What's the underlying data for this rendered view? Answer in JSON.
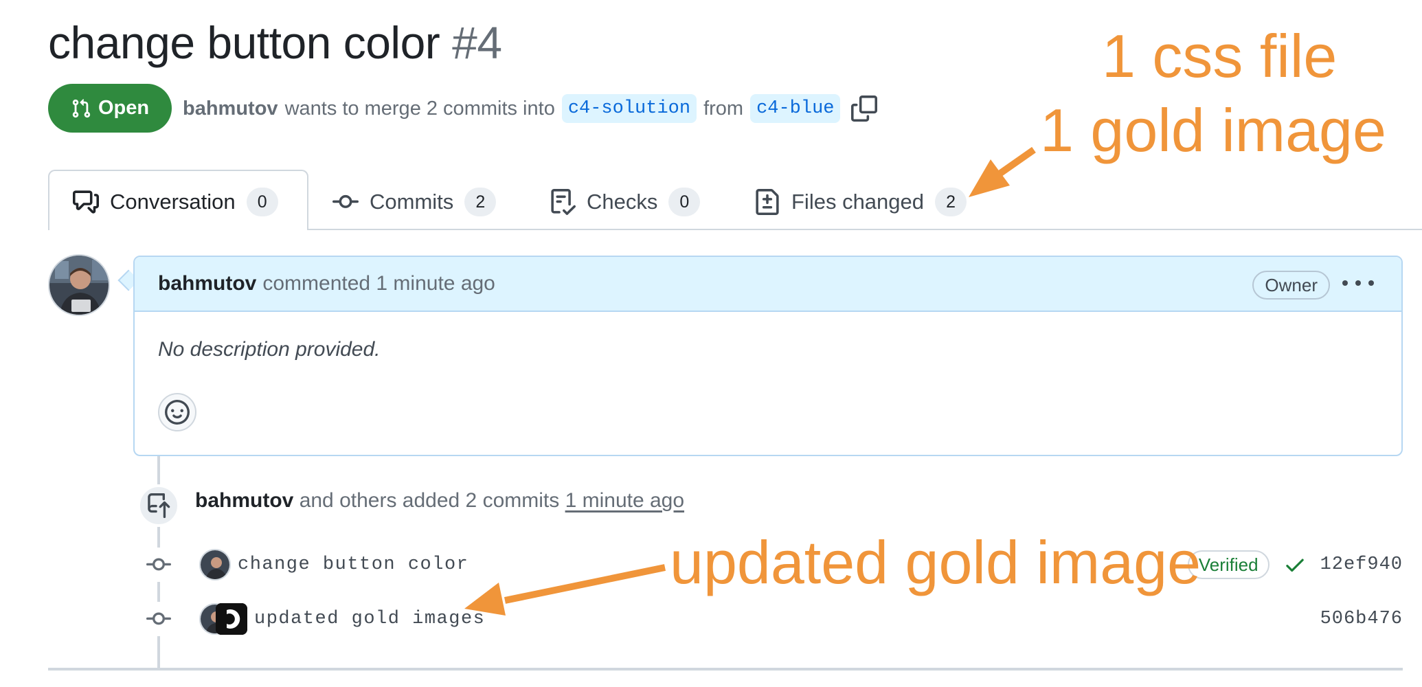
{
  "pr": {
    "title": "change button color",
    "number": "#4",
    "state": "Open",
    "author": "bahmutov",
    "merge_text": "wants to merge 2 commits into",
    "base_branch": "c4-solution",
    "from_text": "from",
    "head_branch": "c4-blue"
  },
  "tabs": [
    {
      "label": "Conversation",
      "count": "0",
      "icon": "comment-discussion-icon"
    },
    {
      "label": "Commits",
      "count": "2",
      "icon": "git-commit-icon"
    },
    {
      "label": "Checks",
      "count": "0",
      "icon": "checklist-icon"
    },
    {
      "label": "Files changed",
      "count": "2",
      "icon": "file-diff-icon"
    }
  ],
  "comment": {
    "author": "bahmutov",
    "action": "commented 1 minute ago",
    "role_badge": "Owner",
    "body": "No description provided."
  },
  "timeline": {
    "author": "bahmutov",
    "text": "and others added 2 commits",
    "time": "1 minute ago",
    "commits": [
      {
        "message": "change button color",
        "verified": "Verified",
        "sha": "12ef940"
      },
      {
        "message": "updated gold images",
        "sha": "506b476"
      }
    ]
  },
  "annotations": {
    "top_line1": "1 css file",
    "top_line2": "1 gold image",
    "middle": "updated gold image",
    "color": "#f0953a"
  },
  "colors": {
    "open_green": "#2f8a3e",
    "link_blue": "#0969da",
    "header_blue": "#ddf4ff"
  }
}
